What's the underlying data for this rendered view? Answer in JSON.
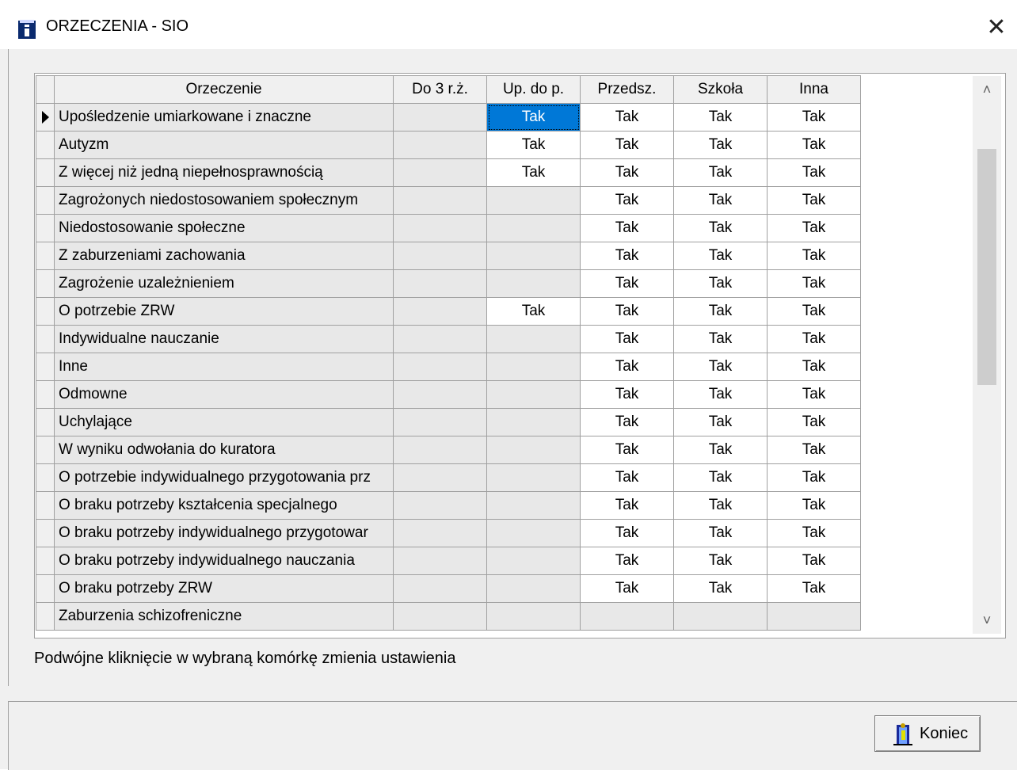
{
  "window": {
    "title": "ORZECZENIA - SIO",
    "close_glyph": "✕",
    "icon": "info-book-icon"
  },
  "grid": {
    "columns": [
      "Orzeczenie",
      "Do 3 r.ż.",
      "Up. do p.",
      "Przedsz.",
      "Szkoła",
      "Inna"
    ],
    "rows": [
      {
        "name": "Upośledzenie umiarkowane i znaczne",
        "cells": [
          "",
          "Tak",
          "Tak",
          "Tak",
          "Tak"
        ]
      },
      {
        "name": "Autyzm",
        "cells": [
          "",
          "Tak",
          "Tak",
          "Tak",
          "Tak"
        ]
      },
      {
        "name": "Z więcej niż jedną niepełnosprawnością",
        "cells": [
          "",
          "Tak",
          "Tak",
          "Tak",
          "Tak"
        ]
      },
      {
        "name": "Zagrożonych niedostosowaniem społecznym",
        "cells": [
          "",
          "",
          "Tak",
          "Tak",
          "Tak"
        ]
      },
      {
        "name": "Niedostosowanie społeczne",
        "cells": [
          "",
          "",
          "Tak",
          "Tak",
          "Tak"
        ]
      },
      {
        "name": "Z zaburzeniami zachowania",
        "cells": [
          "",
          "",
          "Tak",
          "Tak",
          "Tak"
        ]
      },
      {
        "name": "Zagrożenie uzależnieniem",
        "cells": [
          "",
          "",
          "Tak",
          "Tak",
          "Tak"
        ]
      },
      {
        "name": "O potrzebie ZRW",
        "cells": [
          "",
          "Tak",
          "Tak",
          "Tak",
          "Tak"
        ]
      },
      {
        "name": "Indywidualne nauczanie",
        "cells": [
          "",
          "",
          "Tak",
          "Tak",
          "Tak"
        ]
      },
      {
        "name": "Inne",
        "cells": [
          "",
          "",
          "Tak",
          "Tak",
          "Tak"
        ]
      },
      {
        "name": "Odmowne",
        "cells": [
          "",
          "",
          "Tak",
          "Tak",
          "Tak"
        ]
      },
      {
        "name": "Uchylające",
        "cells": [
          "",
          "",
          "Tak",
          "Tak",
          "Tak"
        ]
      },
      {
        "name": "W wyniku odwołania do kuratora",
        "cells": [
          "",
          "",
          "Tak",
          "Tak",
          "Tak"
        ]
      },
      {
        "name": "O potrzebie indywidualnego przygotowania prz",
        "cells": [
          "",
          "",
          "Tak",
          "Tak",
          "Tak"
        ]
      },
      {
        "name": "O braku potrzeby kształcenia specjalnego",
        "cells": [
          "",
          "",
          "Tak",
          "Tak",
          "Tak"
        ]
      },
      {
        "name": "O braku potrzeby indywidualnego przygotowar",
        "cells": [
          "",
          "",
          "Tak",
          "Tak",
          "Tak"
        ]
      },
      {
        "name": "O braku potrzeby indywidualnego nauczania",
        "cells": [
          "",
          "",
          "Tak",
          "Tak",
          "Tak"
        ]
      },
      {
        "name": "O braku potrzeby ZRW",
        "cells": [
          "",
          "",
          "Tak",
          "Tak",
          "Tak"
        ]
      },
      {
        "name": "Zaburzenia schizofreniczne",
        "cells": [
          "",
          "",
          "",
          "",
          ""
        ]
      }
    ],
    "current_row": 0,
    "selected_cell": {
      "row": 0,
      "col": 1
    }
  },
  "hint": "Podwójne kliknięcie w wybraną komórkę zmienia ustawienia",
  "footer": {
    "close_button_label": "Koniec",
    "close_button_icon": "door-exit-icon"
  },
  "colors": {
    "selection": "#0078d7",
    "readonly_cell": "#e8e8e8",
    "editable_cell": "#ffffff"
  }
}
